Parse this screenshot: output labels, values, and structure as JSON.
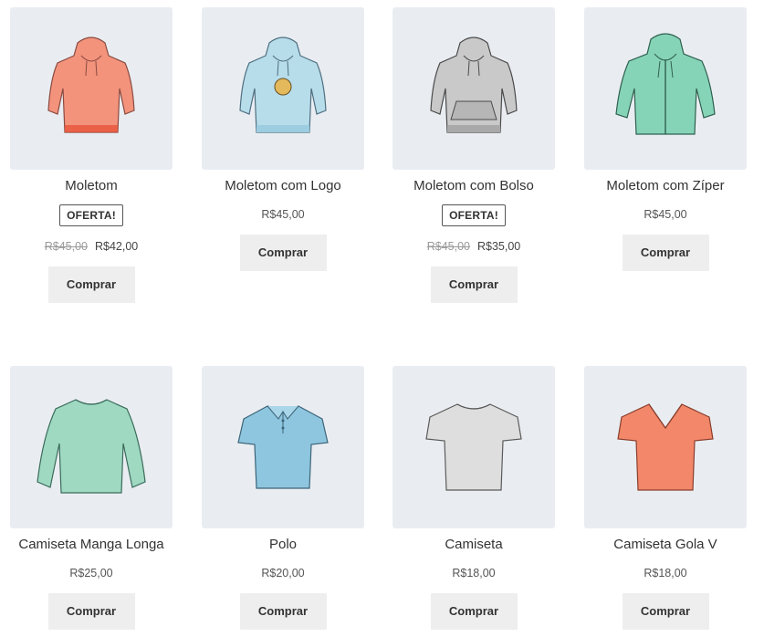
{
  "products": [
    {
      "name": "Moletom",
      "badge": "OFERTA!",
      "old_price": "R$45,00",
      "price": "R$42,00",
      "button": "Comprar",
      "image": "hoodie-illustration",
      "color": "#f3937c"
    },
    {
      "name": "Moletom com Logo",
      "price": "R$45,00",
      "button": "Comprar",
      "image": "hoodie-with-logo-illustration",
      "color": "#b7dcea"
    },
    {
      "name": "Moletom com Bolso",
      "badge": "OFERTA!",
      "old_price": "R$45,00",
      "price": "R$35,00",
      "button": "Comprar",
      "image": "hoodie-with-pocket-illustration",
      "color": "#c9c9c9"
    },
    {
      "name": "Moletom com Zíper",
      "price": "R$45,00",
      "button": "Comprar",
      "image": "zip-hoodie-illustration",
      "color": "#86d4b8"
    },
    {
      "name": "Camiseta Manga Longa",
      "price": "R$25,00",
      "button": "Comprar",
      "image": "long-sleeve-tee-illustration",
      "color": "#9fd9c2"
    },
    {
      "name": "Polo",
      "price": "R$20,00",
      "button": "Comprar",
      "image": "polo-illustration",
      "color": "#8ec6df"
    },
    {
      "name": "Camiseta",
      "price": "R$18,00",
      "button": "Comprar",
      "image": "tshirt-illustration",
      "color": "#dedede"
    },
    {
      "name": "Camiseta Gola V",
      "price": "R$18,00",
      "button": "Comprar",
      "image": "vneck-tshirt-illustration",
      "color": "#f2876a"
    }
  ]
}
